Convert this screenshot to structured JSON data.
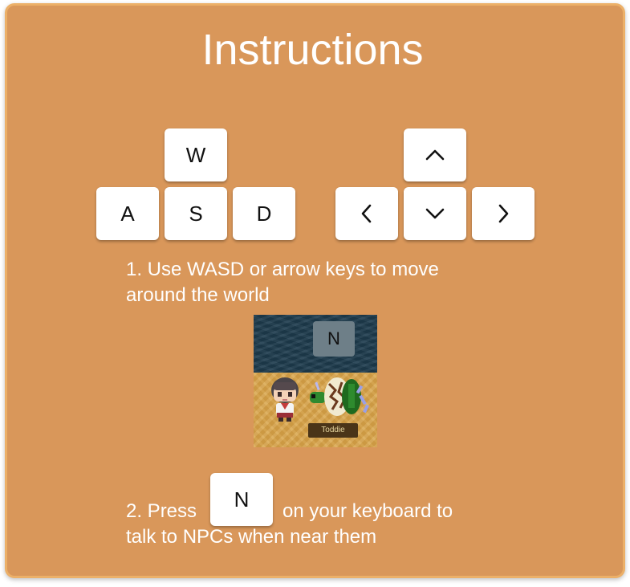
{
  "title": "Instructions",
  "keys": {
    "wasd": {
      "w": "W",
      "a": "A",
      "s": "S",
      "d": "D"
    },
    "arrows": {
      "up": "chevron-up-icon",
      "left": "chevron-left-icon",
      "down": "chevron-down-icon",
      "right": "chevron-right-icon"
    },
    "talk_key": "N"
  },
  "step1": {
    "line1": "1. Use WASD or arrow keys to move",
    "line2": "around the world"
  },
  "scene": {
    "key_prompt": "N",
    "npc_name": "Toddie"
  },
  "step2": {
    "prefix": "2. Press",
    "suffix": "on your keyboard to",
    "line2": "talk to NPCs when near them"
  },
  "colors": {
    "panel": "#d9975a",
    "panel_border": "#ecb068",
    "key": "#ffffff",
    "text": "#ffffff"
  }
}
